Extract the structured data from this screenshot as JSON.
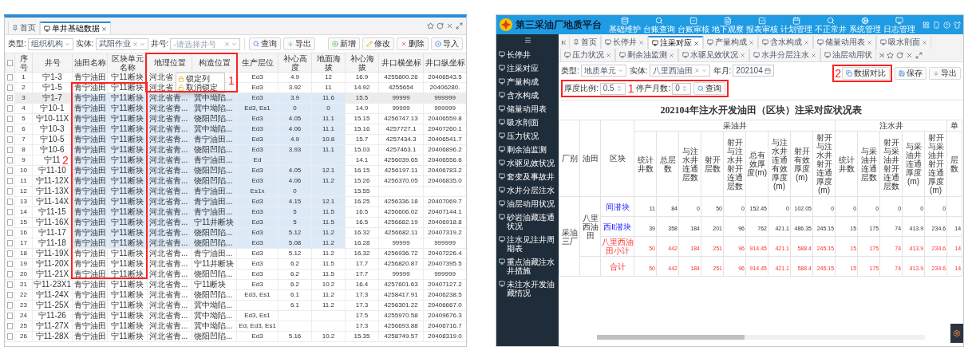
{
  "left": {
    "tabs": [
      {
        "label": "首页",
        "selected": false,
        "closable": false
      },
      {
        "label": "单井基础数据",
        "selected": true,
        "closable": true
      }
    ],
    "filters": [
      {
        "label": "类型:",
        "value": "组织机构",
        "clearable": false
      },
      {
        "label": "实体:",
        "value": "武阳作业",
        "clearable": true
      },
      {
        "label": "井号:",
        "placeholder": "-请选择井号",
        "clearable": true
      }
    ],
    "query_buttons": [
      {
        "kind": "search",
        "label": "查询"
      },
      {
        "kind": "export",
        "label": "导出"
      }
    ],
    "action_buttons": [
      {
        "kind": "add",
        "label": "新增"
      },
      {
        "kind": "edit",
        "label": "修改"
      },
      {
        "kind": "delete",
        "label": "删除"
      },
      {
        "kind": "import",
        "label": "导入"
      }
    ],
    "table": {
      "all_checked": false,
      "columns": [
        {
          "label": "序号",
          "kind": "number",
          "in_selection": false
        },
        {
          "label": "井号",
          "kind": "text",
          "in_selection": false
        },
        {
          "label": "油田名称",
          "kind": "text",
          "in_selection": true
        },
        {
          "label": "区块单元名称",
          "kind": "text",
          "in_selection": true
        },
        {
          "label": "地理位置",
          "kind": "long",
          "in_selection": true
        },
        {
          "label": "构造位置",
          "kind": "long",
          "in_selection": true
        },
        {
          "label": "生产层位",
          "kind": "number",
          "in_selection": true
        },
        {
          "label": "补心高度",
          "kind": "number",
          "in_selection": true
        },
        {
          "label": "地面海拔",
          "kind": "number",
          "in_selection": true
        },
        {
          "label": "补心海拔",
          "kind": "number",
          "in_selection": false
        },
        {
          "label": "井口横坐标",
          "kind": "number",
          "in_selection": false
        },
        {
          "label": "井口纵坐标",
          "kind": "number",
          "in_selection": false
        }
      ],
      "rows": [
        {
          "checked": false,
          "in_selection": false,
          "cells": [
            "1",
            "宁1-3",
            "青宁油田",
            "宁11断块",
            "河北省",
            null,
            "Ed3",
            "4.9",
            "12",
            "16.9",
            "4255800.26",
            "20406543.5"
          ]
        },
        {
          "checked": false,
          "in_selection": false,
          "cells": [
            "2",
            "宁1-5",
            "青宁油田",
            "宁11断块",
            "河北省",
            null,
            "Ed3",
            "3.92",
            "11",
            "14.92",
            "4255654",
            "20406280."
          ]
        },
        {
          "checked": true,
          "in_selection": true,
          "cells": [
            "3",
            "宁1-7",
            "青宁油田",
            "宁11断块",
            "河北省青...",
            "冀中坳陷...",
            "Ed3",
            "3.9",
            "11.6",
            "15.5",
            "99999",
            "999999"
          ]
        },
        {
          "checked": false,
          "in_selection": true,
          "cells": [
            "4",
            "宁10-1",
            "青宁油田",
            "宁11断块",
            "河北省青...",
            "冀中坳陷...",
            "Ed3, Es1",
            "0",
            "0",
            "14.9",
            "99999",
            "999999"
          ]
        },
        {
          "checked": false,
          "in_selection": true,
          "cells": [
            "5",
            "宁10-11X",
            "青宁油田",
            "宁11断块",
            "河北省青...",
            "饶阳凹陷...",
            "Ed3",
            "4.05",
            "11.1",
            "15.15",
            "4256747.13",
            "20406559.8"
          ]
        },
        {
          "checked": false,
          "in_selection": true,
          "cells": [
            "6",
            "宁10-3",
            "青宁油田",
            "宁11断块",
            "河北省青...",
            "冀中坳陷...",
            "Ed3",
            "4.06",
            "11.1",
            "15.16",
            "4257727.1",
            "20407260.1"
          ]
        },
        {
          "checked": false,
          "in_selection": true,
          "cells": [
            "7",
            "宁10-5",
            "青宁油田",
            "宁11断块",
            "河北省青...",
            "青宁油田...",
            "Ed3",
            "4.9",
            "10.8",
            "15.7",
            "4257434.3",
            "20406541.7"
          ]
        },
        {
          "checked": false,
          "in_selection": true,
          "cells": [
            "8",
            "宁10-6",
            "青宁油田",
            "宁11断块",
            "河北省青...",
            "饶阳凹陷...",
            "Ed3",
            "3.93",
            "11.1",
            "15.03",
            "4257463.1",
            "20406896.2"
          ]
        },
        {
          "checked": false,
          "in_selection": true,
          "cells": [
            "9",
            "宁11",
            "青宁油田",
            "宁11断块",
            "河北省青...",
            "青宁油田...",
            "Ed",
            null,
            null,
            "14.1",
            "4256039.65",
            "20406556.6"
          ]
        },
        {
          "checked": false,
          "in_selection": true,
          "cells": [
            "10",
            "宁11-10",
            "青宁油田",
            "宁11断块",
            "河北省青...",
            "饶阳凹陷...",
            "Ed3",
            "4.05",
            "12.1",
            "16.15",
            "4256197.11",
            "20406783.2"
          ]
        },
        {
          "checked": false,
          "in_selection": true,
          "cells": [
            "11",
            "宁11-12X",
            "青宁油田",
            "宁11断块",
            "河北省青...",
            "饶阳凹陷...",
            "Ed3",
            "4.06",
            "11.2",
            "15.26",
            "4256370.05",
            "20406835.0"
          ]
        },
        {
          "checked": false,
          "in_selection": true,
          "cells": [
            "12",
            "宁11-13X",
            "青宁油田",
            "宁11断块",
            "河北省青...",
            "青宁油田...",
            "Es1x",
            "0",
            null,
            "15.55",
            null,
            null
          ]
        },
        {
          "checked": false,
          "in_selection": true,
          "cells": [
            "13",
            "宁11-14X",
            "青宁油田",
            "宁11断块",
            "河北省青...",
            "青宁油田...",
            "Ed3",
            "4.15",
            "12.1",
            "16.25",
            "4256336.18",
            "20407069.7"
          ]
        },
        {
          "checked": false,
          "in_selection": true,
          "cells": [
            "14",
            "宁11-15",
            "青宁油田",
            "宁11断块",
            "河北省青...",
            "青宁油田...",
            "Ed3",
            "5",
            "11.5",
            "16.5",
            "4256606.02",
            "20407144.1"
          ]
        },
        {
          "checked": false,
          "in_selection": true,
          "cells": [
            "15",
            "宁11-16X",
            "青宁油田",
            "宁11断块",
            "河北省青...",
            "宁11井断块",
            "Ed3",
            "5",
            "11.5",
            "16.5",
            "4256682.19",
            "20406918.8"
          ]
        },
        {
          "checked": false,
          "in_selection": true,
          "cells": [
            "16",
            "宁11-17",
            "青宁油田",
            "宁11断块",
            "河北省青...",
            "饶阳凹陷...",
            "Ed3",
            "5.12",
            "11.2",
            "16.32",
            "4256682.11",
            "20407319.2"
          ]
        },
        {
          "checked": false,
          "in_selection": true,
          "cells": [
            "17",
            "宁11-18",
            "青宁油田",
            "宁11断块",
            "河北省青...",
            "饶阳凹陷...",
            "Ed3",
            "5.08",
            "11.2",
            "16.28",
            "99999",
            "999999"
          ]
        },
        {
          "checked": false,
          "in_selection": false,
          "cells": [
            "18",
            "宁11-19X",
            "青宁油田",
            "宁11断块",
            "河北省青...",
            "青宁油田...",
            "Ed3",
            "5.12",
            "11.2",
            "16.32",
            "4256936.72",
            "20407226.4"
          ]
        },
        {
          "checked": false,
          "in_selection": false,
          "cells": [
            "19",
            "宁11-20X",
            "青宁油田",
            "宁11断块",
            "河北省青...",
            "宁11井断块",
            "Ed3",
            "6.2",
            "11.5",
            "17.7",
            "4256820.87",
            "20407395.5"
          ]
        },
        {
          "checked": false,
          "in_selection": false,
          "cells": [
            "20",
            "宁11-21X",
            "青宁油田",
            "宁11断块",
            "河北省青...",
            "饶阳凹陷...",
            "Ed3",
            "6.2",
            "11.5",
            "17.7",
            "99999",
            "999999"
          ]
        },
        {
          "checked": false,
          "in_selection": false,
          "cells": [
            "21",
            "宁11-23X1",
            "青宁油田",
            "宁11断块",
            "河北省青...",
            "宁11断块",
            "Ed3",
            "6.2",
            "10.2",
            "16.4",
            "4257601.63",
            "20407127.2"
          ]
        },
        {
          "checked": false,
          "in_selection": false,
          "cells": [
            "22",
            "宁11-24X",
            "青宁油田",
            "宁11断块",
            "河北省青...",
            "饶阳凹陷...",
            "Ed3, Es1",
            "6.1",
            "11.2",
            "17.3",
            "4258417.91",
            "20406238.5"
          ]
        },
        {
          "checked": false,
          "in_selection": false,
          "cells": [
            "23",
            "宁11-25X",
            "青宁油田",
            "宁11断块",
            "河北省青...",
            "冀中坳陷...",
            null,
            "6.1",
            "11.2",
            "17.3",
            "4256301.22",
            "20406667.0"
          ]
        },
        {
          "checked": false,
          "in_selection": false,
          "cells": [
            "24",
            "宁11-26",
            "青宁油田",
            "宁11断块",
            "河北省青...",
            "冀中坳陷...",
            "Ed3, Es1",
            null,
            null,
            "17.5",
            "4255970.58",
            "20409676.3"
          ]
        },
        {
          "checked": false,
          "in_selection": false,
          "cells": [
            "25",
            "宁11-27X",
            "青宁油田",
            "宁11断块",
            "河北省青...",
            "冀中坳陷...",
            "Ed, Ed3, Es1",
            null,
            null,
            "17.3",
            "4256693.88",
            "20406716.7"
          ]
        },
        {
          "checked": false,
          "in_selection": false,
          "cells": [
            "26",
            "宁11-28X",
            "青宁油田",
            "宁11断块",
            "河北省青...",
            "饶阳凹陷...",
            "Ed3",
            "5.16",
            "10.2",
            "15.35",
            "4258749.57",
            "20408319.0"
          ]
        }
      ]
    },
    "context_menu": [
      {
        "kind": "lock",
        "label": "锁定列"
      },
      {
        "kind": "unlock",
        "label": "取消锁定"
      }
    ],
    "annotations": [
      {
        "label": "1"
      },
      {
        "label": "2"
      }
    ]
  },
  "right": {
    "app_title": "第三采油厂地质平台",
    "nav": [
      {
        "kind": "database",
        "label": "基础维护"
      },
      {
        "kind": "search",
        "label": "台账查询"
      },
      {
        "kind": "check",
        "label": "台账审核"
      },
      {
        "kind": "document",
        "label": "地下观察"
      },
      {
        "kind": "check-big",
        "label": "报表审核"
      },
      {
        "kind": "calendar",
        "label": "计划管理"
      },
      {
        "kind": "search",
        "label": "不正常井"
      },
      {
        "kind": "gears",
        "label": "系统管理"
      },
      {
        "kind": "monitor",
        "label": "日志管理"
      }
    ],
    "sidebar": [
      "长停井",
      "注采对应",
      "产量构成",
      "含水构成",
      "储量动用表",
      "吸水剖面",
      "压力状况",
      "剩余油监测",
      "水驱见效状况",
      "套变及事故井",
      "水井分层注水",
      "油层动用状况",
      "砂岩油藏连通状况",
      "注水见注井周期表",
      "重点油藏注水井措施",
      "未注水开发油藏情况"
    ],
    "tabs": [
      {
        "label": "首页",
        "selected": false,
        "closable": false
      },
      {
        "label": "长停井",
        "selected": false,
        "closable": true
      },
      {
        "label": "注采对应",
        "selected": true,
        "closable": true
      },
      {
        "label": "产量构成",
        "selected": false,
        "closable": true
      },
      {
        "label": "含水构成",
        "selected": false,
        "closable": true
      },
      {
        "label": "储量动用表",
        "selected": false,
        "closable": true
      },
      {
        "label": "吸水剖面",
        "selected": false,
        "closable": true
      },
      {
        "label": "压力状况",
        "selected": false,
        "closable": true
      },
      {
        "label": "剩余油监测",
        "selected": false,
        "closable": true
      },
      {
        "label": "水驱见效状况",
        "selected": false,
        "closable": true
      },
      {
        "label": "水井分层注水",
        "selected": false,
        "closable": true
      },
      {
        "label": "油层动用状",
        "selected": false,
        "closable": false
      }
    ],
    "filters": [
      {
        "kind": "select",
        "label": "类型:",
        "value": "地质单元"
      },
      {
        "kind": "tag-select",
        "label": "实体:",
        "value": "八里西油田"
      },
      {
        "kind": "date",
        "label": "年月:",
        "value": "202104"
      },
      {
        "kind": "number",
        "label": "厚度比例:",
        "value": "0.5"
      },
      {
        "kind": "number",
        "label": "停产月数:",
        "value": "0"
      }
    ],
    "search_button": "查询",
    "actions": [
      {
        "kind": "compare",
        "label": "数据对比"
      },
      {
        "kind": "save",
        "label": "保存"
      },
      {
        "kind": "export",
        "label": "导出"
      }
    ],
    "annotations": [
      {
        "label": "1"
      },
      {
        "label": "2"
      }
    ],
    "report": {
      "title": "202104年注水开发油田（区块）注采对应状况表",
      "fixed_columns": [
        "厂别",
        "油田",
        "区块"
      ],
      "groups": [
        {
          "label": "采油井",
          "columns": [
            "统计井数",
            "总层数",
            "与注水井连通层数",
            "射开层数",
            "射开与注水井射开连通层数",
            "总有效厚度(m)",
            "与注水井连通有效厚度(m)",
            "射开有效厚度(m)",
            "射开与注水井射开连通厚度(m)"
          ]
        },
        {
          "label": "注水井",
          "columns": [
            "统计井数",
            "与采油井连通层数",
            "射开与采油井射开连通层数",
            "与采油井连通厚度(m)",
            "射开与采油井射开连通厚度(m)"
          ]
        },
        {
          "label": "单",
          "columns": [
            "层数"
          ]
        }
      ],
      "factory": "采油三厂",
      "oilfield": "八里西油田",
      "rows": [
        {
          "kind": "block",
          "block": "间潜块",
          "values": [
            "11",
            "84",
            "0",
            "50",
            "0",
            "152.45",
            "0",
            "102.05",
            "0",
            "0",
            "0",
            "0",
            "0",
            "0"
          ]
        },
        {
          "kind": "block",
          "block": "西Ⅱ潜块",
          "values": [
            "39",
            "358",
            "184",
            "201",
            "96",
            "762",
            "421.1",
            "486.35",
            "245.15",
            "15",
            "175",
            "74",
            "413.9",
            "234.6",
            "14"
          ]
        },
        {
          "kind": "subtotal",
          "block": "八里西油田小计",
          "values": [
            "50",
            "442",
            "184",
            "251",
            "96",
            "914.45",
            "421.1",
            "588.4",
            "245.15",
            "15",
            "175",
            "74",
            "413.9",
            "234.6",
            "14"
          ]
        },
        {
          "kind": "total",
          "block": "合计",
          "values": [
            "50",
            "442",
            "184",
            "251",
            "96",
            "914.45",
            "421.1",
            "588.4",
            "245.15",
            "15",
            "175",
            "74",
            "413.9",
            "234.6",
            "14"
          ]
        }
      ]
    }
  }
}
